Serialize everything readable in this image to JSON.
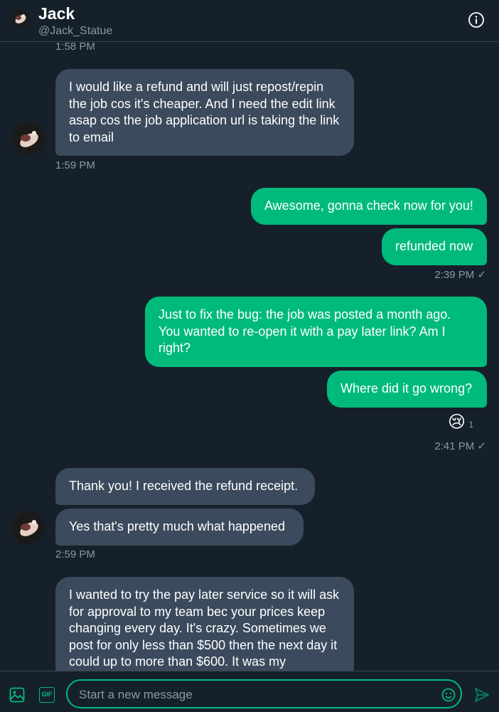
{
  "header": {
    "name": "Jack",
    "handle": "@Jack_Statue"
  },
  "messages": {
    "ts_0": "1:58 PM",
    "m1": "I would like a refund and will just repost/repin the job cos it's cheaper. And I need the edit link asap cos the job application url is taking the link to email",
    "ts_1": "1:59 PM",
    "m2": "Awesome, gonna check now for you!",
    "m3": "refunded now",
    "ts_2": "2:39 PM ✓",
    "m4": "Just to fix the bug: the job was posted a month ago. You wanted to re-open it with a pay later link? Am I right?",
    "m5": "Where did it go wrong?",
    "reaction_emoji": "😢",
    "reaction_count": "1",
    "ts_3": "2:41 PM ✓",
    "m6": "Thank you! I received the refund receipt.",
    "m7": "Yes that's pretty much what happened",
    "ts_4": "2:59 PM",
    "m8": "I wanted to try the pay later service so it will ask for approval to my team bec your prices keep changing every day. It's crazy. Sometimes we post for only less than $500 then the next day it could up to more than $600. It was my"
  },
  "composer": {
    "placeholder": "Start a new message",
    "gif_label": "GIF"
  },
  "colors": {
    "background": "#15202b",
    "incoming_bubble": "#3b4a5c",
    "outgoing_bubble": "#00ba7c",
    "muted_text": "#8b98a5"
  }
}
